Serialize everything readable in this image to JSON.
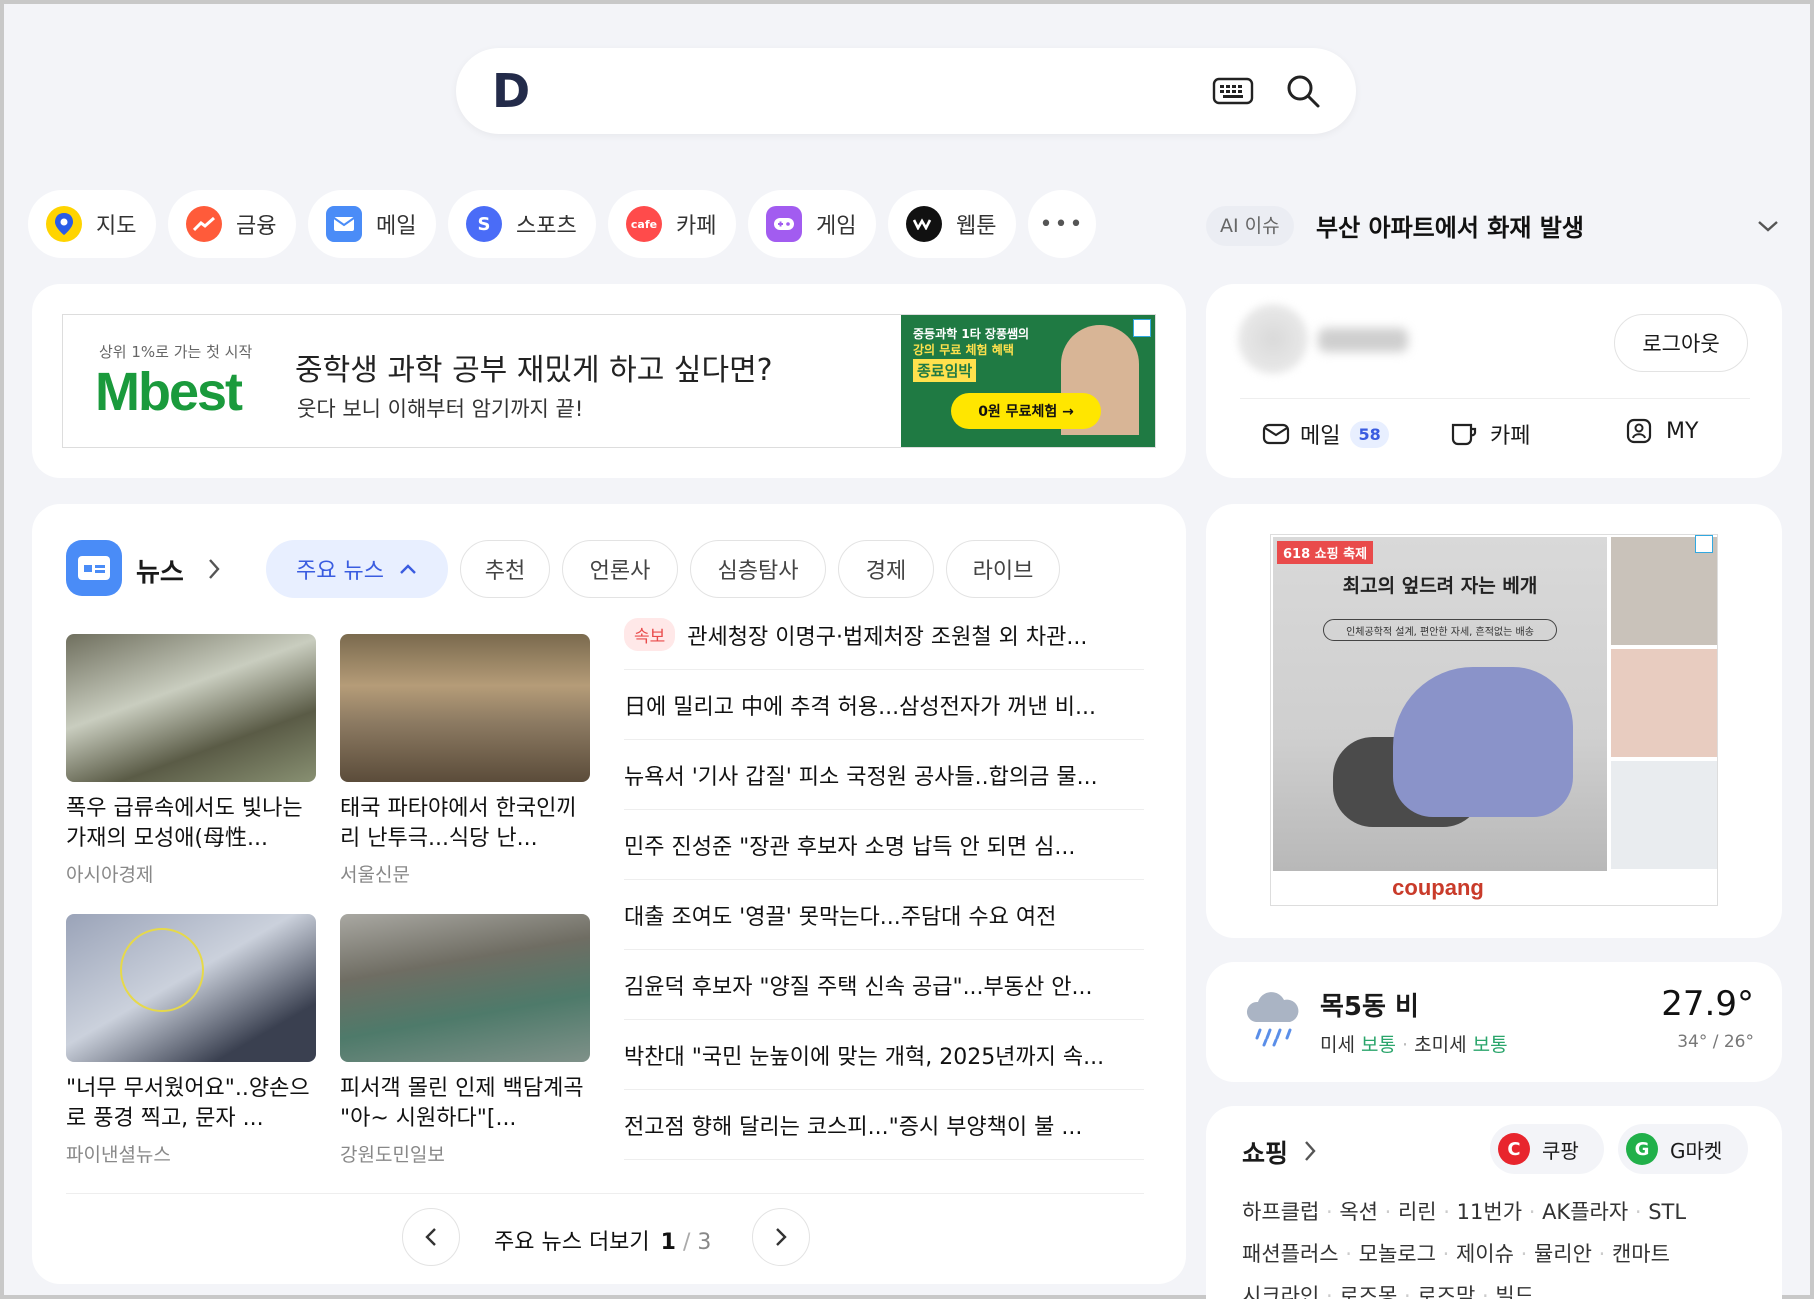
{
  "search": {
    "logo": "D"
  },
  "services": [
    "지도",
    "금융",
    "메일",
    "스포츠",
    "카페",
    "게임",
    "웹툰"
  ],
  "ai_issue": {
    "tag": "AI 이슈",
    "headline": "부산 아파트에서 화재 발생"
  },
  "banner_ad": {
    "brand_tagline": "상위 1%로 가는 첫 시작",
    "brand": "Mbest",
    "headline": "중학생 과학 공부 재밌게 하고 싶다면?",
    "subline": "웃다 보니 이해부터 암기까지 끝!",
    "promo_line1": "중등과학 1타 장풍쌤의",
    "promo_line2": "강의 무료 체험 혜택",
    "promo_badge": "종료임박",
    "cta": "0원 무료체험 →"
  },
  "news": {
    "title": "뉴스",
    "tabs": [
      "주요 뉴스",
      "추천",
      "언론사",
      "심층탐사",
      "경제",
      "라이브"
    ],
    "photo_items": [
      {
        "caption": "폭우 급류속에서도 빛나는 가재의 모성애(母性...",
        "source": "아시아경제"
      },
      {
        "caption": "태국 파타야에서 한국인끼리 난투극...식당 난...",
        "source": "서울신문"
      },
      {
        "caption": "\"너무 무서웠어요\"..양손으로 풍경 찍고, 문자 ...",
        "source": "파이낸셜뉴스"
      },
      {
        "caption": "피서객 몰린 인제 백담계곡 \"아~ 시원하다\"[...",
        "source": "강원도민일보"
      }
    ],
    "breaking_badge": "속보",
    "headlines": [
      "관세청장 이명구·법제처장 조원철 외 차관...",
      "日에 밀리고 中에 추격 허용...삼성전자가 꺼낸 비...",
      "뉴욕서 '기사 갑질' 피소 국정원 공사들..합의금 물...",
      "민주 진성준 \"장관 후보자 소명 납득 안 되면 심...",
      "대출 조여도 '영끌' 못막는다...주담대 수요 여전",
      "김윤덕 후보자 \"양질 주택 신속 공급\"...부동산 안...",
      "박찬대 \"국민 눈높이에 맞는 개혁, 2025년까지 속...",
      "전고점 향해 달리는 코스피...\"증시 부양책이 불 ..."
    ],
    "more_label": "주요 뉴스 더보기",
    "page_current": "1",
    "page_total": "3"
  },
  "account": {
    "logout": "로그아웃",
    "mail_label": "메일",
    "mail_count": "58",
    "cafe_label": "카페",
    "my_label": "MY"
  },
  "side_ad": {
    "badge": "618 쇼핑 축제",
    "headline": "최고의 엎드려 자는 베개",
    "sub": "인체공학적 설계, 편안한 자세, 흔적없는 배송",
    "brand": "coupang"
  },
  "weather": {
    "location": "목5동",
    "condition": "비",
    "temp": "27.9°",
    "range": "34° / 26°",
    "dust_label": "미세",
    "dust_value": "보통",
    "fine_dust_label": "초미세",
    "fine_dust_value": "보통"
  },
  "shopping": {
    "title": "쇼핑",
    "chip1": "쿠팡",
    "chip2": "G마켓",
    "row1": [
      "하프클럽",
      "옥션",
      "리린",
      "11번가",
      "AK플라자",
      "STL"
    ],
    "row2": [
      "패션플러스",
      "모놀로그",
      "제이슈",
      "뮬리안",
      "캔마트"
    ],
    "row3": [
      "시크라인",
      "로즈몽",
      "로즈맘",
      "빌드"
    ]
  },
  "colors": {
    "accent": "#4a6cf7",
    "good": "#2aa56b",
    "breaking": "#e94b4b"
  }
}
